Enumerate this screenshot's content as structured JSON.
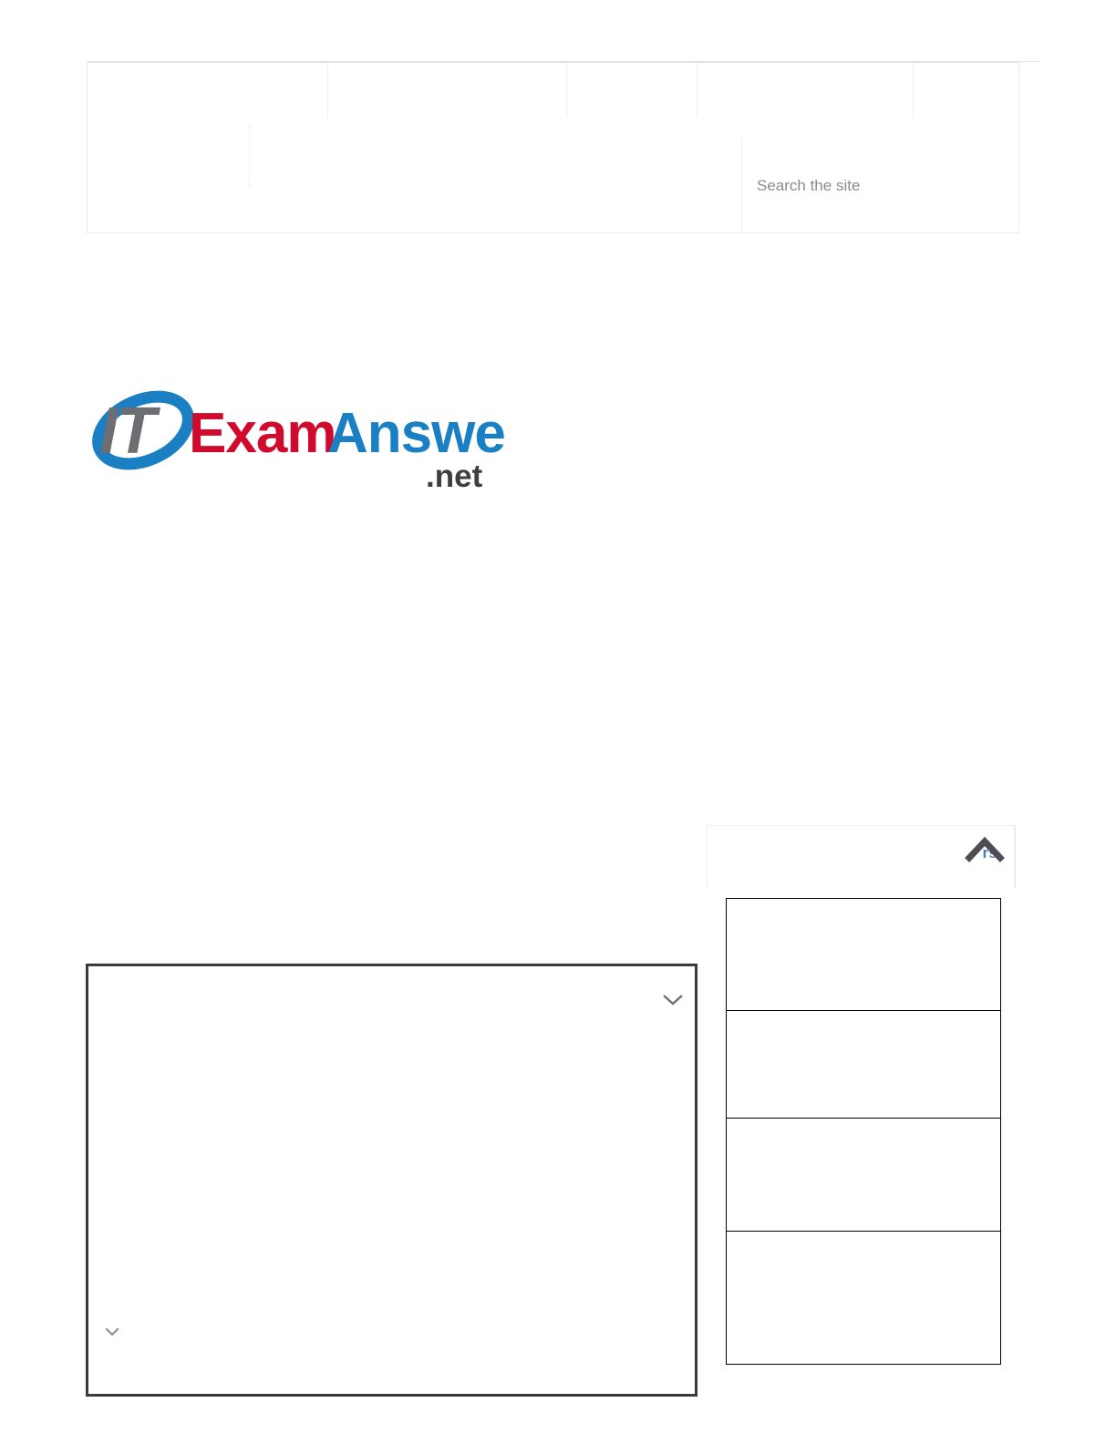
{
  "site": {
    "logo": {
      "alt": "ITExamAnswers.net",
      "text_it": "IT",
      "text_exam": "Exam",
      "text_answers": "Answers",
      "text_tld": ".net",
      "color_it": "#6d6e71",
      "color_swoosh": "#1b7fc4",
      "color_exam": "#cf0a2c",
      "color_answers": "#1b7fc4",
      "color_tld": "#3f3f3f"
    }
  },
  "navbar": {
    "primary_items": [
      {
        "label": ""
      },
      {
        "label": ""
      },
      {
        "label": ""
      },
      {
        "label": ""
      },
      {
        "label": ""
      }
    ],
    "secondary_items": [
      {
        "label": ""
      },
      {
        "label": ""
      }
    ]
  },
  "search": {
    "placeholder": "Search the site",
    "value": ""
  },
  "sidebar": {
    "heading_fragment": "rs",
    "heading_color": "#4a7fba",
    "collapse_icon": "chevron-up-icon",
    "items": [
      {
        "title": ""
      },
      {
        "title": ""
      },
      {
        "title": ""
      },
      {
        "title": ""
      }
    ]
  },
  "main": {
    "expand_icon": "chevron-down-icon",
    "expand_icon_secondary": "chevron-down-icon",
    "body_text": ""
  }
}
